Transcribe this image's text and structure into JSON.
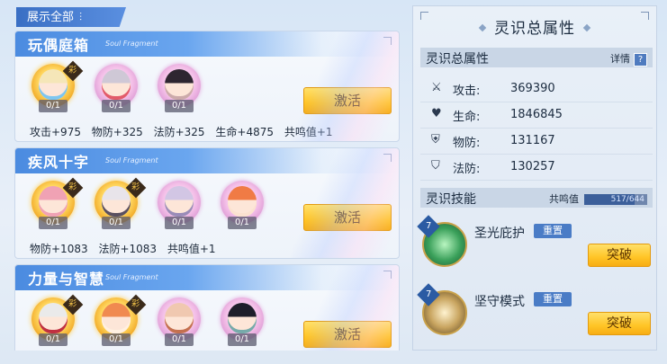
{
  "header": {
    "show_all_label": "展示全部",
    "show_all_icon": "filter-icon"
  },
  "fragments": [
    {
      "name": "玩偶庭箱",
      "sub": "Soul Fragment",
      "chars": [
        {
          "count": "0/1",
          "ring": "gold",
          "badge": "彩",
          "hair": "#f5e6b8",
          "accent": "#7ec6f0"
        },
        {
          "count": "0/1",
          "ring": "pink",
          "badge": "",
          "hair": "#cfc8d6",
          "accent": "#e25a6a"
        },
        {
          "count": "0/1",
          "ring": "pink",
          "badge": "",
          "hair": "#2e2630",
          "accent": "#caa"
        }
      ],
      "activate": "激活",
      "stats": [
        "攻击+975",
        "物防+325",
        "法防+325",
        "生命+4875",
        "共鸣值+1"
      ]
    },
    {
      "name": "疾风十字",
      "sub": "Soul Fragment",
      "chars": [
        {
          "count": "0/1",
          "ring": "gold",
          "badge": "彩",
          "hair": "#f0a2b4",
          "accent": "#f0a2b4"
        },
        {
          "count": "0/1",
          "ring": "gold",
          "badge": "彩",
          "hair": "#e8e4ea",
          "accent": "#5a5060"
        },
        {
          "count": "0/1",
          "ring": "pink",
          "badge": "",
          "hair": "#d2c6e4",
          "accent": "#9a8cb8"
        },
        {
          "count": "0/1",
          "ring": "pink",
          "badge": "",
          "hair": "#f07b45",
          "accent": "#fbe2d0"
        }
      ],
      "activate": "激活",
      "stats": [
        "物防+1083",
        "法防+1083",
        "共鸣值+1"
      ]
    },
    {
      "name": "力量与智慧",
      "sub": "Soul Fragment",
      "chars": [
        {
          "count": "0/1",
          "ring": "gold",
          "badge": "彩",
          "hair": "#eaeaea",
          "accent": "#c03040"
        },
        {
          "count": "0/1",
          "ring": "gold",
          "badge": "彩",
          "hair": "#f08a50",
          "accent": "#fff0e0"
        },
        {
          "count": "0/1",
          "ring": "pink",
          "badge": "",
          "hair": "#f0c8b0",
          "accent": "#c47050"
        },
        {
          "count": "0/1",
          "ring": "pink",
          "badge": "",
          "hair": "#1e1e2a",
          "accent": "#7aa"
        }
      ],
      "activate": "激活",
      "stats": []
    }
  ],
  "panel": {
    "title": "灵识总属性",
    "section_title": "灵识总属性",
    "detail_label": "详情",
    "detail_icon": "?",
    "attrs": [
      {
        "icon": "sword-icon",
        "glyph": "⚔",
        "label": "攻击:",
        "value": "369390"
      },
      {
        "icon": "heart-icon",
        "glyph": "♥",
        "label": "生命:",
        "value": "1846845"
      },
      {
        "icon": "shield-icon",
        "glyph": "⛨",
        "label": "物防:",
        "value": "131167"
      },
      {
        "icon": "magic-shield-icon",
        "glyph": "⛉",
        "label": "法防:",
        "value": "130257"
      }
    ],
    "skills_title": "灵识技能",
    "resonance_label": "共鸣值",
    "resonance_value": "517/644",
    "resonance_fraction": 0.803,
    "skills": [
      {
        "level": "7",
        "name": "圣光庇护",
        "reset": "重置",
        "break": "突破",
        "color": "#3aa05a"
      },
      {
        "level": "7",
        "name": "坚守模式",
        "reset": "重置",
        "break": "突破",
        "color": "#c9a560"
      }
    ]
  }
}
